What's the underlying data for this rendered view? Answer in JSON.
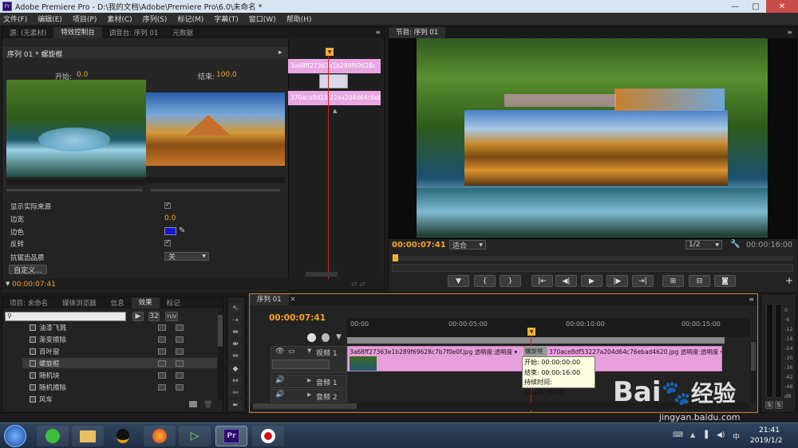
{
  "window": {
    "title": "Adobe Premiere Pro - D:\\我的文档\\Adobe\\Premiere Pro\\6.0\\未命名 *",
    "pr_badge": "Pr",
    "min": "—",
    "max": "□",
    "close": "✕"
  },
  "menu": [
    "文件(F)",
    "编辑(E)",
    "项目(P)",
    "素材(C)",
    "序列(S)",
    "标记(M)",
    "字幕(T)",
    "窗口(W)",
    "帮助(H)"
  ],
  "source_panel": {
    "tabs": [
      "源: (无素材)",
      "特效控制台",
      "调音台: 序列 01",
      "元数据"
    ],
    "header": "序列 01 * 螺旋框",
    "start_label": "开始:",
    "start_value": "0.0",
    "end_label": "结束:",
    "end_value": "100.0",
    "props": [
      {
        "label": "显示实际来源",
        "value": "✓"
      },
      {
        "label": "边宽",
        "value": "0.0"
      },
      {
        "label": "边色",
        "value": ""
      },
      {
        "label": "反转",
        "value": "✓"
      },
      {
        "label": "抗锯齿品质",
        "value": "关"
      }
    ],
    "custom_button": "自定义...",
    "timecode": "00:00:07:41",
    "clip_a": "3a68ff27363e1b289f69628c",
    "clip_b": "370ace8d15.22aa204d64c6eb"
  },
  "program": {
    "tab": "节目: 序列 01",
    "timecode": "00:00:07:41",
    "fit": "适合",
    "quality": "1/2",
    "duration": "00:00:16:00"
  },
  "transport": [
    "▼",
    "{",
    "}",
    "|⇤",
    "◀|",
    "▶",
    "|▶",
    "⇥|",
    "⊞",
    "⊟",
    "◙"
  ],
  "project_panel": {
    "tabs": [
      "项目: 未命名",
      "媒体浏览器",
      "信息",
      "效果",
      "标记"
    ],
    "effects": [
      "油漆飞溅",
      "渐变擦除",
      "百叶窗",
      "螺旋框",
      "随机块",
      "随机擦除",
      "风车"
    ],
    "btn32": "32",
    "btnyuv": "YUV"
  },
  "timeline": {
    "tab": "序列 01",
    "timecode": "00:00:07:41",
    "ruler": [
      "00:00",
      "00:00:05:00",
      "00:00:10:00",
      "00:00:15:00"
    ],
    "video_track": "视频 1",
    "audio_tracks": [
      "音频 1",
      "音频 2"
    ],
    "clip1": "3a68ff27363e1b289f69628c7b7f0e0f.jpg 透明度:透明度 ▾",
    "transition": "螺旋框",
    "clip2": "370ace8df53227a204d64c76ebad4620.jpg 透明度:透明度 ▾",
    "tooltip": {
      "start": "开始: 00:00:00:00",
      "end": "结束: 00:00:16:00",
      "duration": "持续时间: 00:00:16:00"
    }
  },
  "meters": {
    "labels": [
      "0",
      "-6",
      "-12",
      "-18",
      "-24",
      "-30",
      "-36",
      "-42",
      "-48",
      "dB"
    ],
    "solo": [
      "S",
      "S"
    ]
  },
  "taskbar": {
    "time": "21:41",
    "date": "2019/1/2",
    "pr": "Pr",
    "lang": "中"
  },
  "watermark": {
    "brand": "Bai",
    "brand2": "经验",
    "url": "jingyan.baidu.com"
  }
}
